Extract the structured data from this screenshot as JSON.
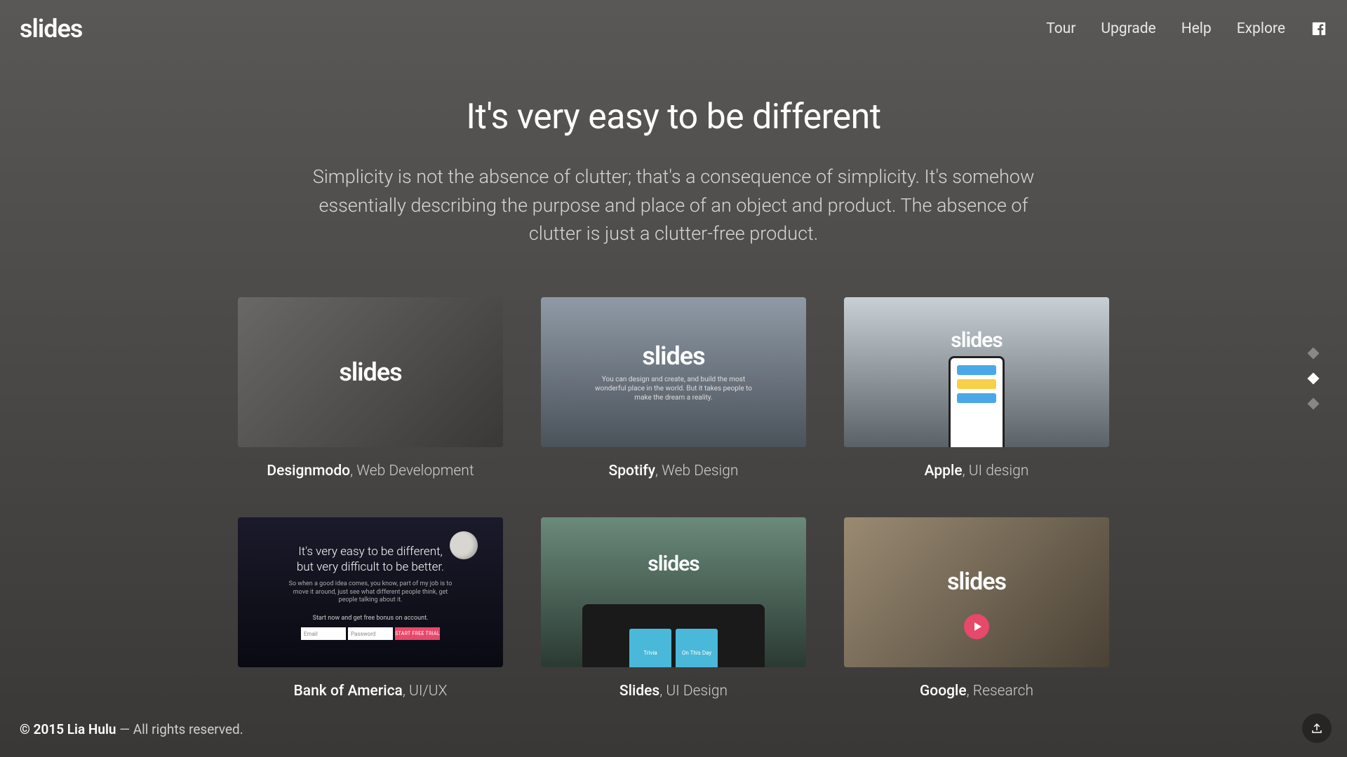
{
  "header": {
    "logo": "slides",
    "nav": [
      "Tour",
      "Upgrade",
      "Help",
      "Explore"
    ]
  },
  "hero": {
    "title": "It's very easy to be different",
    "subtitle": "Simplicity is not the absence of clutter; that's a consequence of simplicity. It's somehow essentially describing the purpose and place of an object and product. The absence of clutter is just a clutter-free product."
  },
  "cards": [
    {
      "logo": "slides",
      "name": "Designmodo",
      "cat": ", Web Development"
    },
    {
      "logo": "slides",
      "tagline": "You can design and create, and build the most wonderful place in the world. But it takes people to make the dream a reality.",
      "name": "Spotify",
      "cat": ", Web Design"
    },
    {
      "logo": "slides",
      "name": "Apple",
      "cat": ", UI design"
    },
    {
      "title_line1": "It's very easy to be different,",
      "title_line2": "but very difficult to be better.",
      "sub": "So when a good idea comes, you know, part of my job is to move it around, just see what different people think, get people talking about it.",
      "small": "Start now and get free bonus on account.",
      "email": "Email",
      "password": "Password",
      "cta": "START FREE TRIAL",
      "name": "Bank of America",
      "cat": ", UI/UX"
    },
    {
      "logo": "slides",
      "tab1": "Trivia",
      "tab2": "On This Day",
      "name": "Slides",
      "cat": ", UI Design"
    },
    {
      "logo": "slides",
      "name": "Google",
      "cat": ", Research"
    }
  ],
  "footer": {
    "copyright": "© 2015 Lia Hulu",
    "rest": " — All rights reserved."
  },
  "pagination": {
    "active": 1,
    "total": 3
  }
}
